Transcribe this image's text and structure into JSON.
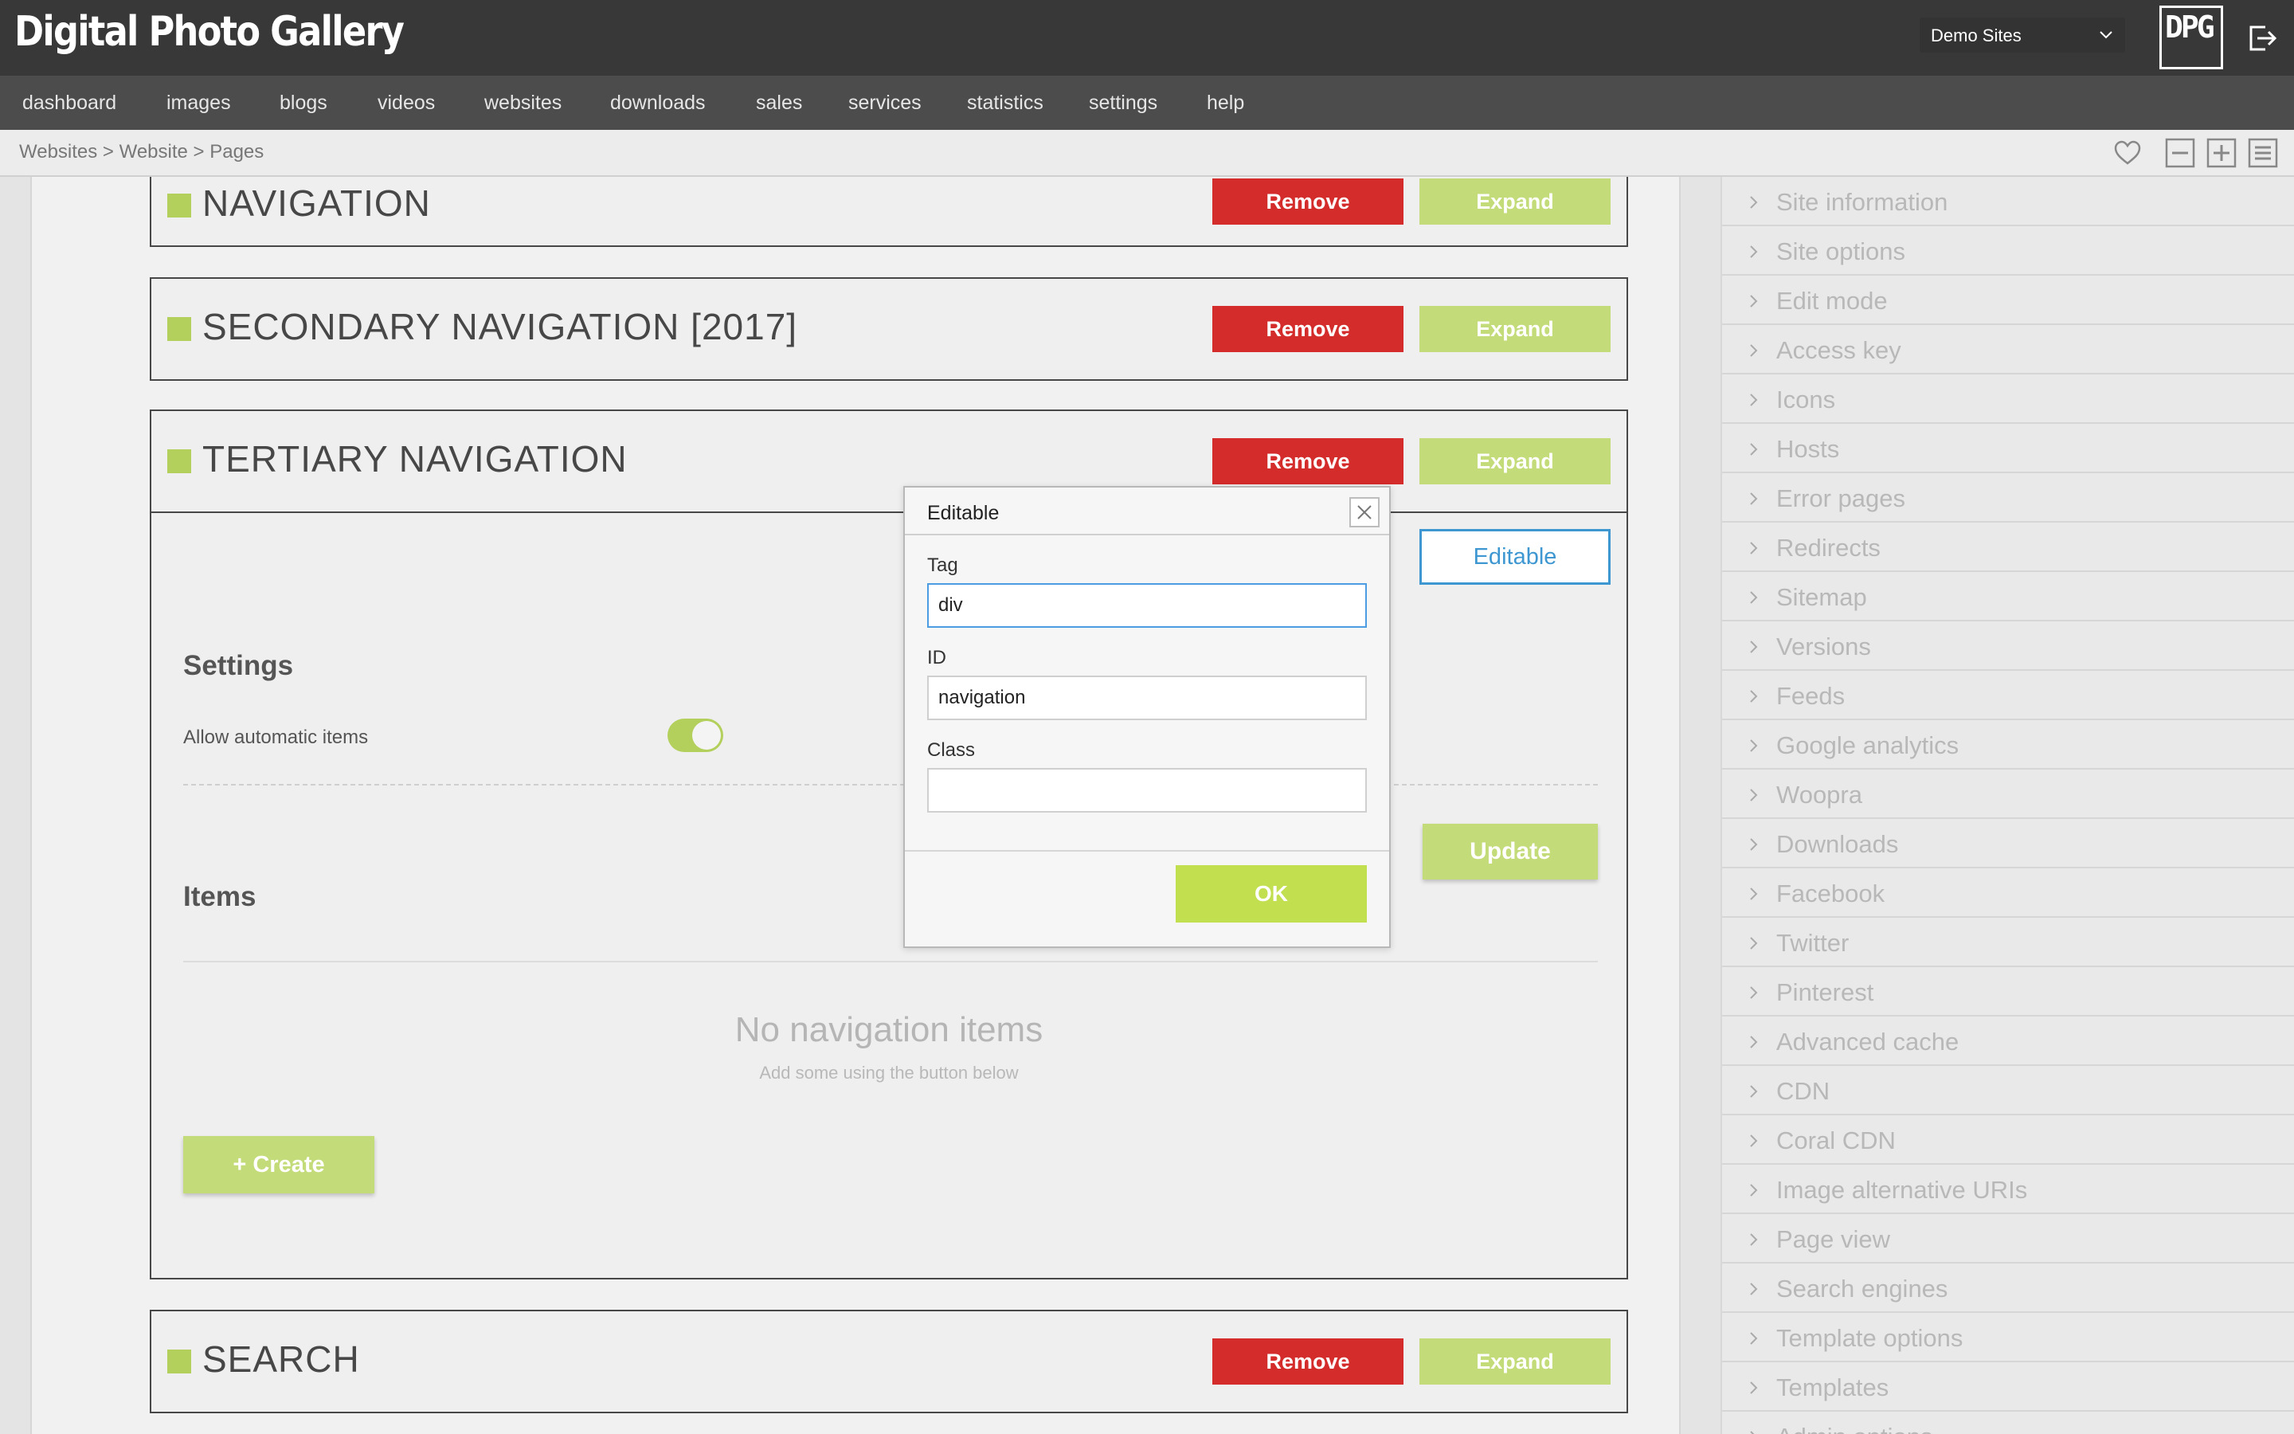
{
  "app": {
    "title": "Digital Photo Gallery",
    "logo_mark": "DPG"
  },
  "site_select": {
    "value": "Demo Sites"
  },
  "nav": [
    {
      "label": "dashboard"
    },
    {
      "label": "images"
    },
    {
      "label": "blogs"
    },
    {
      "label": "videos"
    },
    {
      "label": "websites"
    },
    {
      "label": "downloads"
    },
    {
      "label": "sales"
    },
    {
      "label": "services"
    },
    {
      "label": "statistics"
    },
    {
      "label": "settings"
    },
    {
      "label": "help"
    }
  ],
  "breadcrumb": "Websites > Website > Pages",
  "panels": {
    "remove_label": "Remove",
    "expand_label": "Expand",
    "navigation": {
      "title": "NAVIGATION"
    },
    "secondary": {
      "title": "SECONDARY NAVIGATION [2017]"
    },
    "tertiary": {
      "title": "TERTIARY NAVIGATION",
      "editable_label": "Editable",
      "settings_title": "Settings",
      "allow_auto_label": "Allow automatic items",
      "allow_auto_on": true,
      "update_label": "Update",
      "items_title": "Items",
      "empty_title": "No navigation items",
      "empty_sub": "Add some using the button below",
      "create_label": "Create"
    },
    "search": {
      "title": "SEARCH"
    }
  },
  "dialog": {
    "title": "Editable",
    "tag_label": "Tag",
    "tag_value": "div",
    "id_label": "ID",
    "id_value": "navigation",
    "class_label": "Class",
    "class_value": "",
    "ok_label": "OK"
  },
  "sidebar": {
    "items": [
      {
        "label": "Site information"
      },
      {
        "label": "Site options"
      },
      {
        "label": "Edit mode"
      },
      {
        "label": "Access key"
      },
      {
        "label": "Icons"
      },
      {
        "label": "Hosts"
      },
      {
        "label": "Error pages"
      },
      {
        "label": "Redirects"
      },
      {
        "label": "Sitemap"
      },
      {
        "label": "Versions"
      },
      {
        "label": "Feeds"
      },
      {
        "label": "Google analytics"
      },
      {
        "label": "Woopra"
      },
      {
        "label": "Downloads"
      },
      {
        "label": "Facebook"
      },
      {
        "label": "Twitter"
      },
      {
        "label": "Pinterest"
      },
      {
        "label": "Advanced cache"
      },
      {
        "label": "CDN"
      },
      {
        "label": "Coral CDN"
      },
      {
        "label": "Image alternative URIs"
      },
      {
        "label": "Page view"
      },
      {
        "label": "Search engines"
      },
      {
        "label": "Template options"
      },
      {
        "label": "Templates"
      },
      {
        "label": "Admin options"
      }
    ]
  },
  "colors": {
    "topbar": "#383838",
    "navbar": "#4c4c4c",
    "remove": "#d42b2b",
    "expand": "#c4db79",
    "ok": "#c1df4f",
    "editable_accent": "#3e97d1",
    "square": "#b3cf5c"
  }
}
